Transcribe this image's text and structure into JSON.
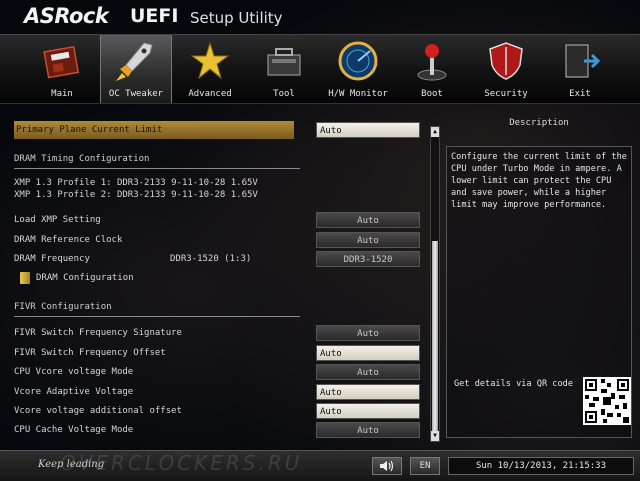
{
  "header": {
    "brand": "ASRock",
    "title_main": "UEFI",
    "title_sub": "Setup Utility"
  },
  "nav": {
    "active": "OC Tweaker",
    "tabs": [
      {
        "label": "Main",
        "icon": "main-board-icon"
      },
      {
        "label": "OC Tweaker",
        "icon": "rocket-icon"
      },
      {
        "label": "Advanced",
        "icon": "star-icon"
      },
      {
        "label": "Tool",
        "icon": "toolbox-icon"
      },
      {
        "label": "H/W Monitor",
        "icon": "radar-icon"
      },
      {
        "label": "Boot",
        "icon": "joystick-icon"
      },
      {
        "label": "Security",
        "icon": "shield-icon"
      },
      {
        "label": "Exit",
        "icon": "exit-door-icon"
      }
    ]
  },
  "settings": {
    "primary_plane": {
      "label": "Primary Plane Current Limit",
      "value": "Auto"
    },
    "dram_timing_header": "DRAM Timing Configuration",
    "xmp_profile_1": "XMP 1.3 Profile 1: DDR3-2133 9-11-10-28 1.65V",
    "xmp_profile_2": "XMP 1.3 Profile 2: DDR3-2133 9-11-10-28 1.65V",
    "load_xmp": {
      "label": "Load XMP Setting",
      "value": "Auto"
    },
    "dram_ref_clock": {
      "label": "DRAM Reference Clock",
      "value": "Auto"
    },
    "dram_freq": {
      "label": "DRAM Frequency",
      "current": "DDR3-1520 (1:3)",
      "value": "DDR3-1520"
    },
    "dram_config": {
      "label": "DRAM Configuration"
    },
    "fivr_header": "FIVR Configuration",
    "fivr_sig": {
      "label": "FIVR Switch Frequency Signature",
      "value": "Auto"
    },
    "fivr_offset": {
      "label": "FIVR Switch Frequency Offset",
      "value": "Auto"
    },
    "cpu_vcore_mode": {
      "label": "CPU Vcore voltage Mode",
      "value": "Auto"
    },
    "vcore_adaptive": {
      "label": "Vcore Adaptive Voltage",
      "value": "Auto"
    },
    "vcore_offset": {
      "label": "Vcore voltage additional offset",
      "value": "Auto"
    },
    "cpu_cache_mode": {
      "label": "CPU Cache Voltage Mode",
      "value": "Auto"
    }
  },
  "description": {
    "title": "Description",
    "text": "Configure the current limit of the CPU under Turbo Mode in ampere. A lower limit can protect the CPU and save power, while a higher limit may improve performance.",
    "qr_label": "Get details via QR code"
  },
  "footer": {
    "slogan": "Keep leading",
    "watermark": "OVERCLOCKERS.RU",
    "language": "EN",
    "datetime": "Sun 10/13/2013, 21:15:33"
  },
  "colors": {
    "highlight": "#b08a3a",
    "background": "#05070c"
  }
}
